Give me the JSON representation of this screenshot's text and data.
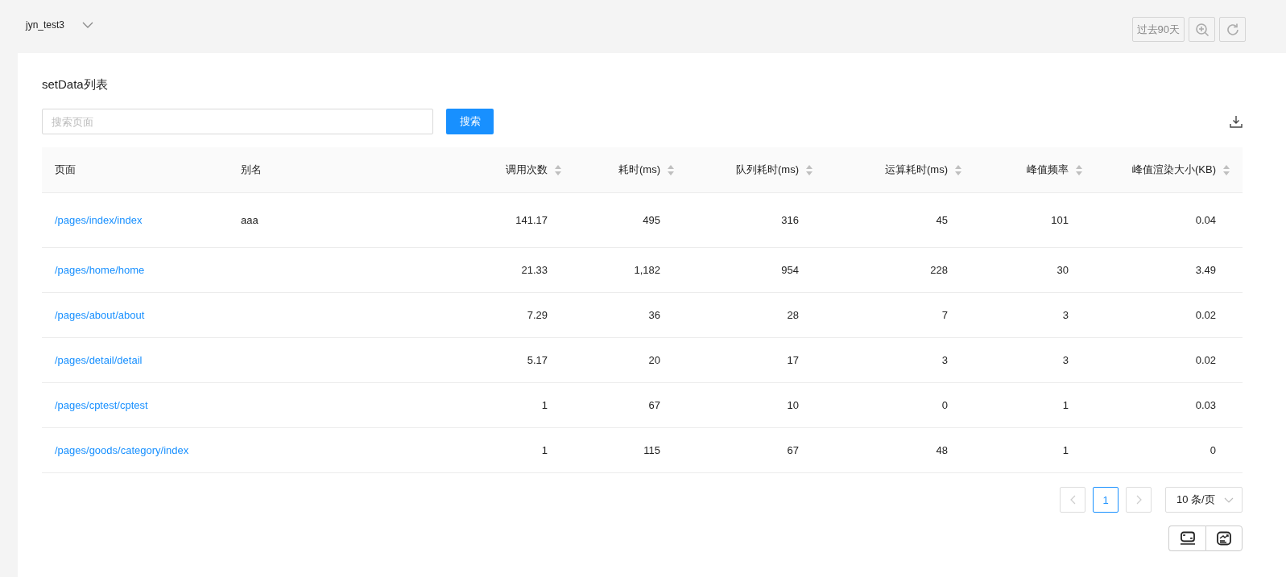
{
  "header": {
    "project": "jyn_test3",
    "range_button": "过去90天"
  },
  "panel": {
    "title": "setData列表",
    "search": {
      "placeholder": "搜索页面"
    },
    "search_button": "搜索"
  },
  "table": {
    "columns": [
      {
        "label": "页面",
        "sortable": false
      },
      {
        "label": "别名",
        "sortable": false
      },
      {
        "label": "调用次数",
        "sortable": true
      },
      {
        "label": "耗时(ms)",
        "sortable": true
      },
      {
        "label": "队列耗时(ms)",
        "sortable": true
      },
      {
        "label": "运算耗时(ms)",
        "sortable": true
      },
      {
        "label": "峰值频率",
        "sortable": true
      },
      {
        "label": "峰值渲染大小(KB)",
        "sortable": true
      }
    ],
    "rows": [
      {
        "cells": [
          "/pages/index/index",
          "aaa",
          "141.17",
          "495",
          "316",
          "45",
          "101",
          "0.04"
        ]
      },
      {
        "cells": [
          "/pages/home/home",
          "",
          "21.33",
          "1,182",
          "954",
          "228",
          "30",
          "3.49"
        ]
      },
      {
        "cells": [
          "/pages/about/about",
          "",
          "7.29",
          "36",
          "28",
          "7",
          "3",
          "0.02"
        ]
      },
      {
        "cells": [
          "/pages/detail/detail",
          "",
          "5.17",
          "20",
          "17",
          "3",
          "3",
          "0.02"
        ]
      },
      {
        "cells": [
          "/pages/cptest/cptest",
          "",
          "1",
          "67",
          "10",
          "0",
          "1",
          "0.03"
        ]
      },
      {
        "cells": [
          "/pages/goods/category/index",
          "",
          "1",
          "115",
          "67",
          "48",
          "1",
          "0"
        ]
      }
    ]
  },
  "pagination": {
    "pages": [
      {
        "label": "1",
        "selected": true
      }
    ],
    "page_size": "10 条/页"
  }
}
